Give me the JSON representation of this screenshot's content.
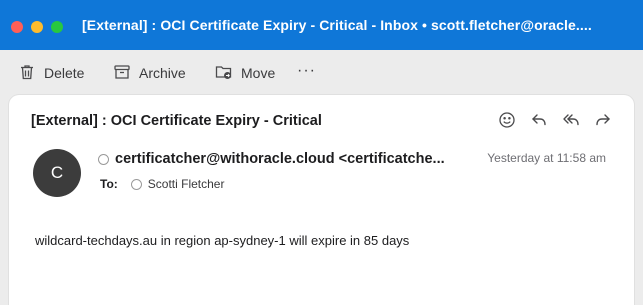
{
  "window": {
    "title": "[External] : OCI Certificate Expiry - Critical - Inbox • scott.fletcher@oracle...."
  },
  "toolbar": {
    "delete_label": "Delete",
    "archive_label": "Archive",
    "move_label": "Move",
    "more_label": "···"
  },
  "message": {
    "subject": "[External] : OCI Certificate Expiry - Critical",
    "avatar_initial": "C",
    "sender": "certificatcher@withoracle.cloud <certificatche...",
    "date": "Yesterday at 11:58 am",
    "to_label": "To:",
    "to_name": "Scotti Fletcher",
    "body": "wildcard-techdays.au in region ap-sydney-1 will expire in 85 days"
  },
  "colors": {
    "titlebar": "#0f77d8",
    "avatar": "#3c3c3c"
  },
  "icons": [
    "trash-icon",
    "archive-icon",
    "move-folder-icon",
    "smiley-icon",
    "reply-icon",
    "reply-all-icon",
    "forward-icon"
  ]
}
